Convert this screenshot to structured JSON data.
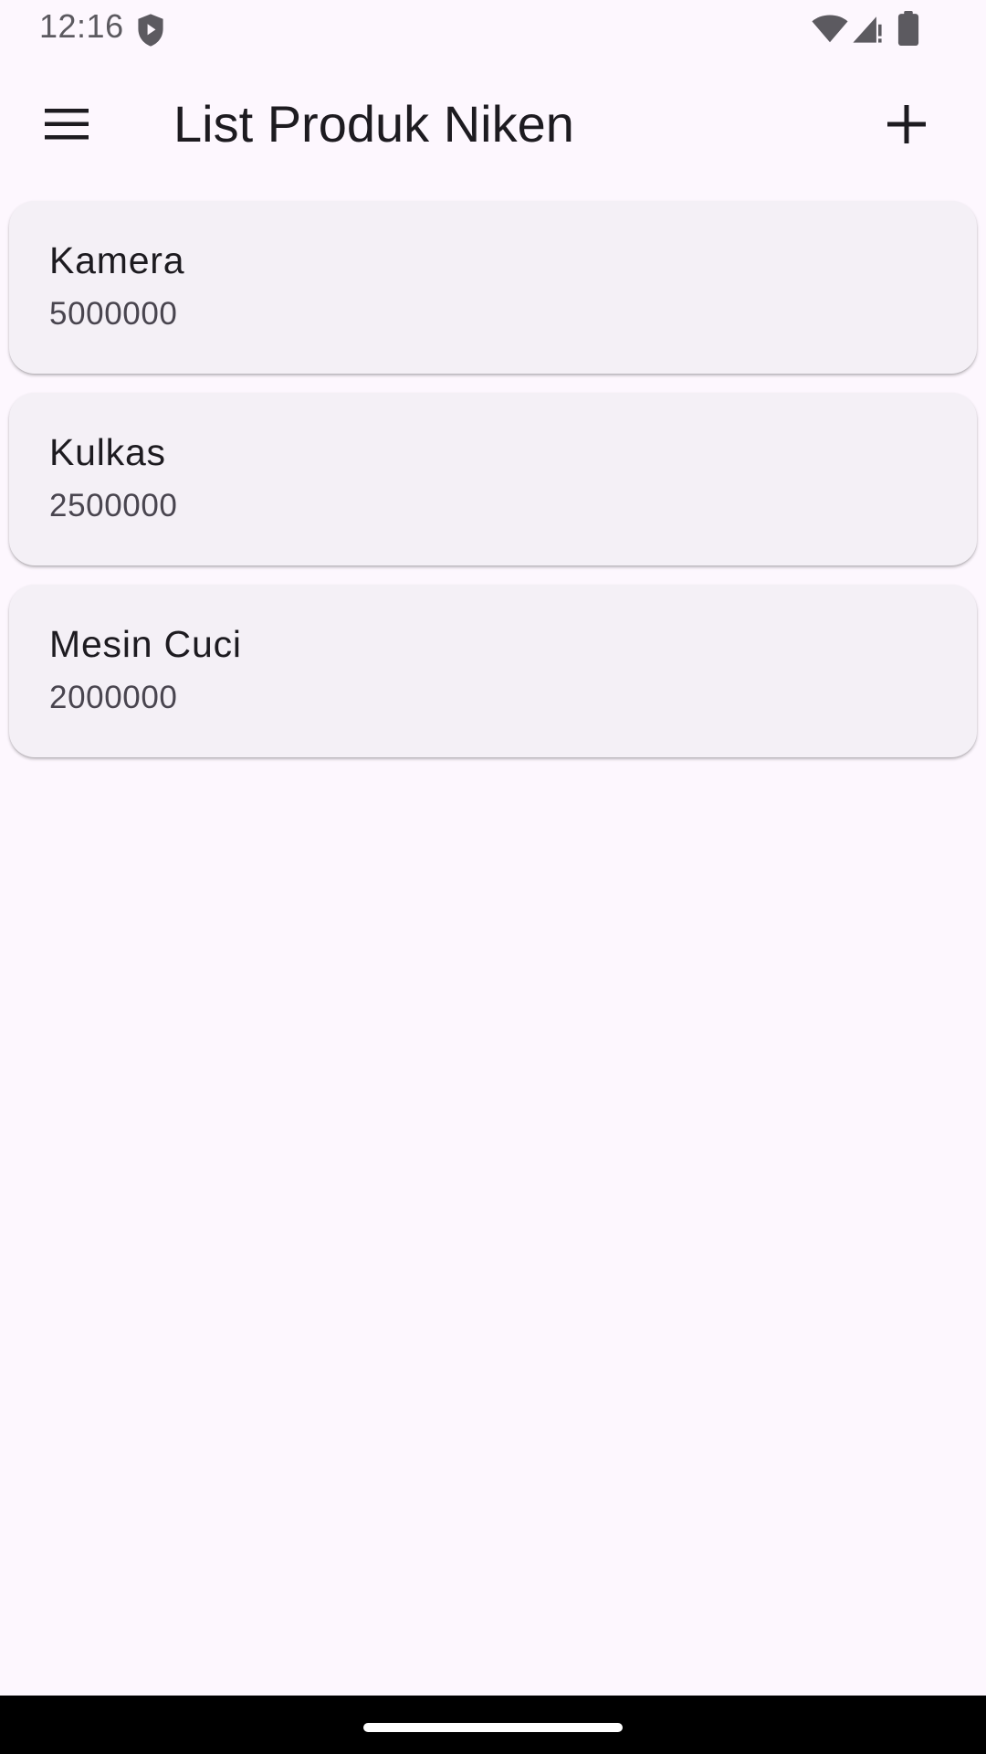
{
  "status_bar": {
    "time": "12:16",
    "icons": [
      "shield-play-icon",
      "wifi-icon",
      "signal-icon",
      "battery-icon"
    ]
  },
  "app_bar": {
    "title": "List Produk Niken",
    "menu_icon": "hamburger-menu-icon",
    "add_icon": "plus-icon"
  },
  "products": [
    {
      "name": "Kamera",
      "price": "5000000"
    },
    {
      "name": "Kulkas",
      "price": "2500000"
    },
    {
      "name": "Mesin Cuci",
      "price": "2000000"
    }
  ],
  "colors": {
    "background": "#fdf7fe",
    "card": "#f4f0f6",
    "text_primary": "#1d1b20",
    "text_secondary": "#49454f"
  }
}
